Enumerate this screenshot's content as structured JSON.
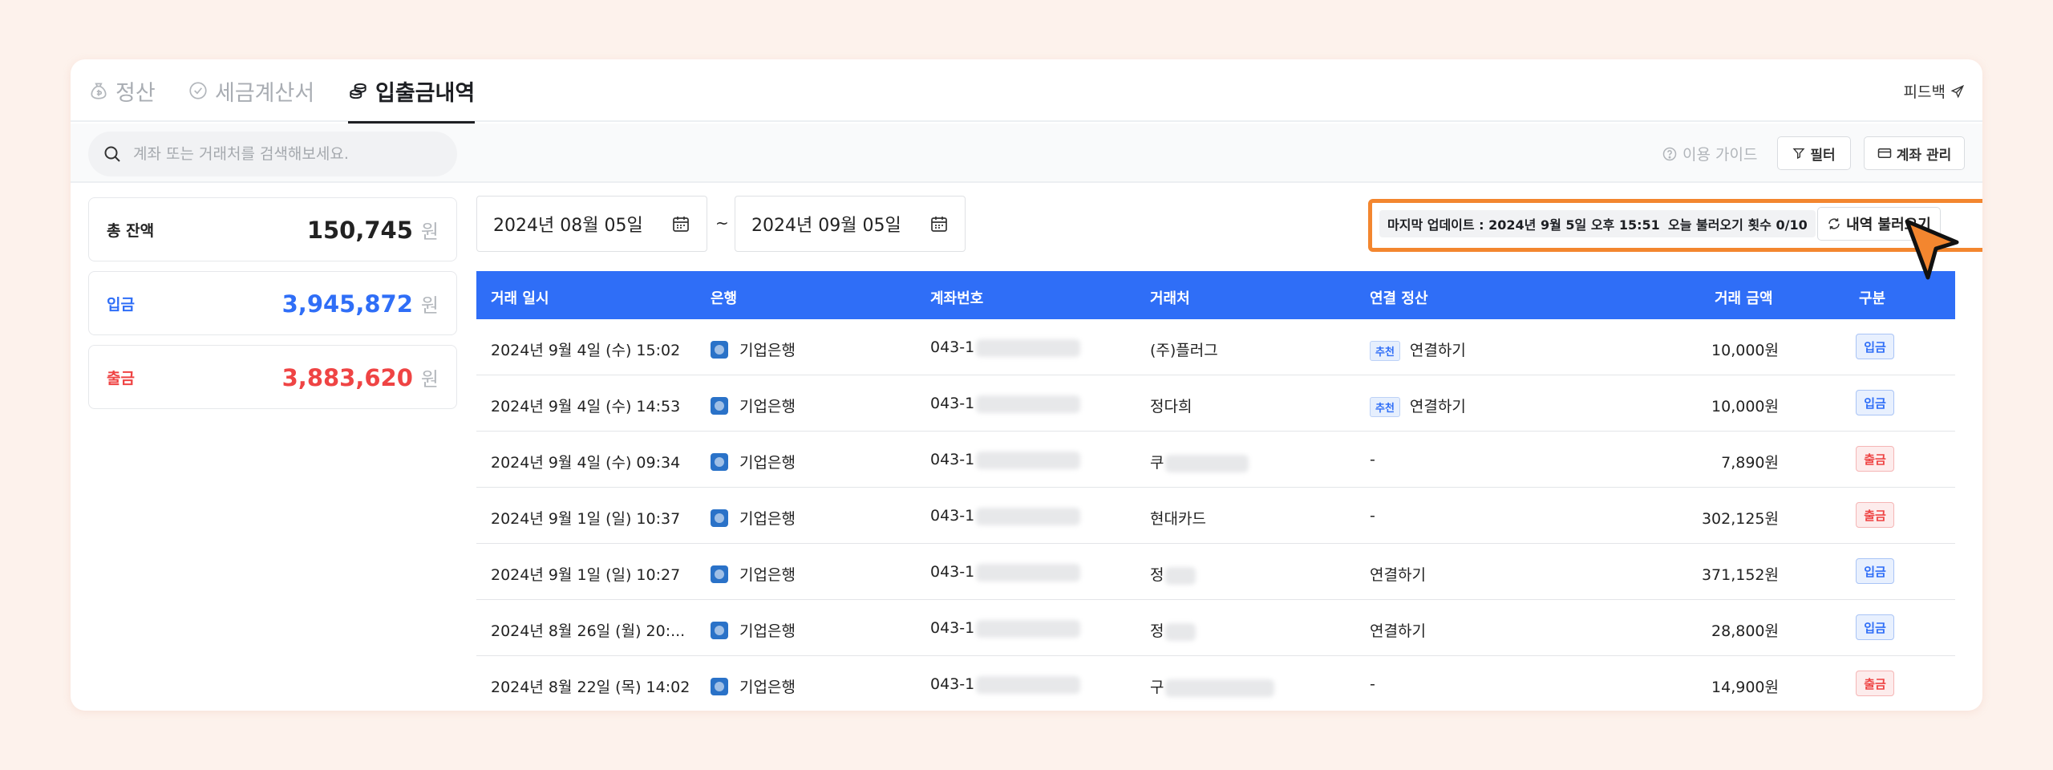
{
  "tabs": [
    {
      "label": "정산",
      "icon": "money-bag-icon"
    },
    {
      "label": "세금계산서",
      "icon": "check-circle-icon"
    },
    {
      "label": "입출금내역",
      "icon": "coins-icon"
    }
  ],
  "feedback_label": "피드백",
  "search": {
    "placeholder": "계좌 또는 거래처를 검색해보세요."
  },
  "toolbar": {
    "guide_label": "이용 가이드",
    "filter_label": "필터",
    "account_label": "계좌 관리"
  },
  "summary": {
    "total": {
      "label": "총 잔액",
      "value": "150,745",
      "unit": "원",
      "color": "#1d1f23"
    },
    "deposit": {
      "label": "입금",
      "value": "3,945,872",
      "unit": "원",
      "color": "#2f6ef7"
    },
    "withdraw": {
      "label": "출금",
      "value": "3,883,620",
      "unit": "원",
      "color": "#ef4444"
    }
  },
  "date_range": {
    "start": "2024년 08월 05일",
    "separator": "~",
    "end": "2024년 09월 05일"
  },
  "status": {
    "last_update": "마지막 업데이트 : 2024년 9월 5일 오후 15:51",
    "reload_count": "오늘 불러오기 횟수 0/10",
    "reload_button": "내역 불러오기"
  },
  "table": {
    "columns": [
      "거래 일시",
      "은행",
      "계좌번호",
      "거래처",
      "연결 정산",
      "거래 금액",
      "구분"
    ],
    "rows": [
      {
        "date": "2024년 9월 4일 (수) 15:02",
        "bank": "기업은행",
        "account": "043-1",
        "party": "(주)플러그",
        "link_tag": "추천",
        "link": "연결하기",
        "amount": "10,000원",
        "kind": "입금"
      },
      {
        "date": "2024년 9월 4일 (수) 14:53",
        "bank": "기업은행",
        "account": "043-1",
        "party": "정다희",
        "link_tag": "추천",
        "link": "연결하기",
        "amount": "10,000원",
        "kind": "입금"
      },
      {
        "date": "2024년 9월 4일 (수) 09:34",
        "bank": "기업은행",
        "account": "043-1",
        "party": "쿠",
        "link_tag": "",
        "link": "-",
        "amount": "7,890원",
        "kind": "출금"
      },
      {
        "date": "2024년 9월 1일 (일) 10:37",
        "bank": "기업은행",
        "account": "043-1",
        "party": "현대카드",
        "link_tag": "",
        "link": "-",
        "amount": "302,125원",
        "kind": "출금"
      },
      {
        "date": "2024년 9월 1일 (일) 10:27",
        "bank": "기업은행",
        "account": "043-1",
        "party": "정",
        "link_tag": "",
        "link": "연결하기",
        "amount": "371,152원",
        "kind": "입금"
      },
      {
        "date": "2024년 8월 26일 (월) 20:...",
        "bank": "기업은행",
        "account": "043-1",
        "party": "정",
        "link_tag": "",
        "link": "연결하기",
        "amount": "28,800원",
        "kind": "입금"
      },
      {
        "date": "2024년 8월 22일 (목) 14:02",
        "bank": "기업은행",
        "account": "043-1",
        "party": "구",
        "link_tag": "",
        "link": "-",
        "amount": "14,900원",
        "kind": "출금"
      }
    ]
  }
}
